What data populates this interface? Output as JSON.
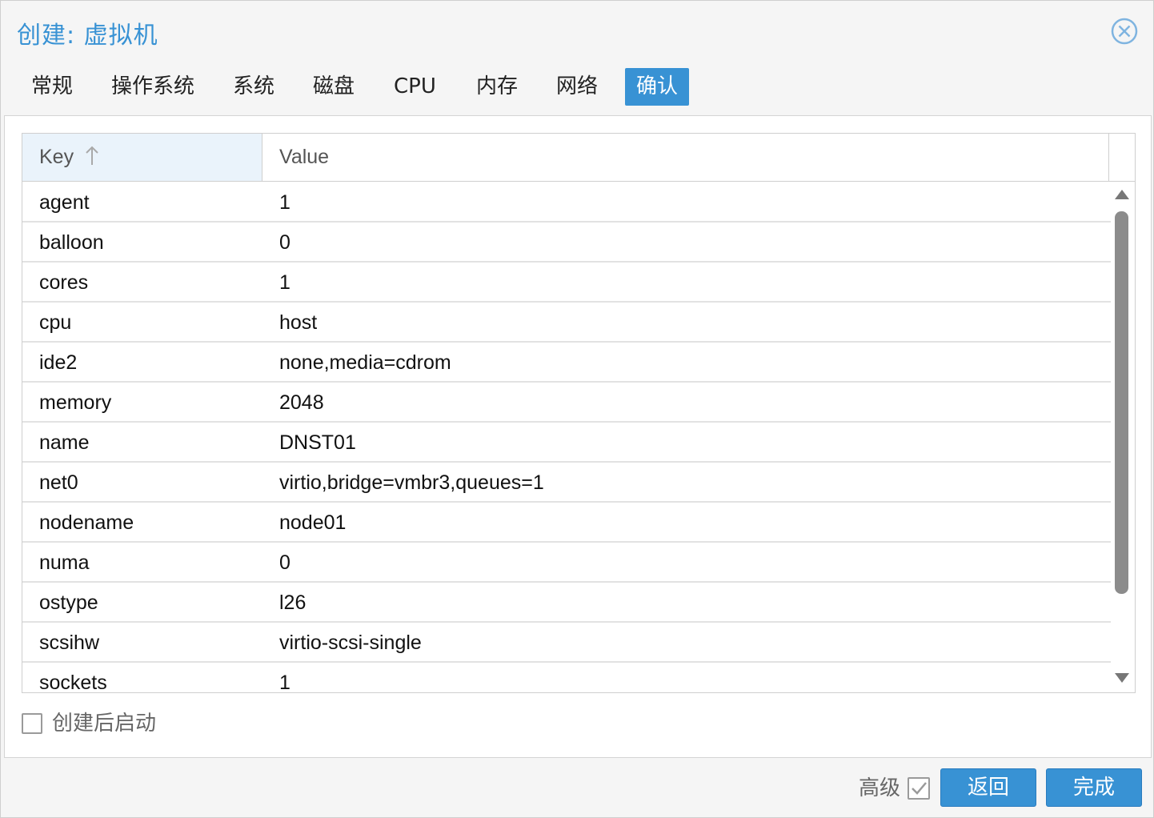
{
  "dialog": {
    "title": "创建: 虚拟机",
    "close_icon": "close-circle-icon"
  },
  "tabs": [
    {
      "label": "常规",
      "active": false
    },
    {
      "label": "操作系统",
      "active": false
    },
    {
      "label": "系统",
      "active": false
    },
    {
      "label": "磁盘",
      "active": false
    },
    {
      "label": "CPU",
      "active": false
    },
    {
      "label": "内存",
      "active": false
    },
    {
      "label": "网络",
      "active": false
    },
    {
      "label": "确认",
      "active": true
    }
  ],
  "grid": {
    "columns": {
      "key": "Key",
      "value": "Value"
    },
    "sort": {
      "column": "Key",
      "direction": "ascending",
      "icon": "sort-up-arrow-icon"
    },
    "rows": [
      {
        "key": "agent",
        "value": "1"
      },
      {
        "key": "balloon",
        "value": "0"
      },
      {
        "key": "cores",
        "value": "1"
      },
      {
        "key": "cpu",
        "value": "host"
      },
      {
        "key": "ide2",
        "value": "none,media=cdrom"
      },
      {
        "key": "memory",
        "value": "2048"
      },
      {
        "key": "name",
        "value": "DNST01"
      },
      {
        "key": "net0",
        "value": "virtio,bridge=vmbr3,queues=1"
      },
      {
        "key": "nodename",
        "value": "node01"
      },
      {
        "key": "numa",
        "value": "0"
      },
      {
        "key": "ostype",
        "value": "l26"
      },
      {
        "key": "scsihw",
        "value": "virtio-scsi-single"
      },
      {
        "key": "sockets",
        "value": "1"
      }
    ]
  },
  "start_after_create": {
    "label": "创建后启动",
    "checked": false
  },
  "footer": {
    "advanced_label": "高级",
    "advanced_checked": true,
    "back_label": "返回",
    "finish_label": "完成"
  },
  "colors": {
    "accent": "#3892d4",
    "header_sorted_bg": "#eaf3fb",
    "scroll_thumb": "#8c8c8c"
  }
}
